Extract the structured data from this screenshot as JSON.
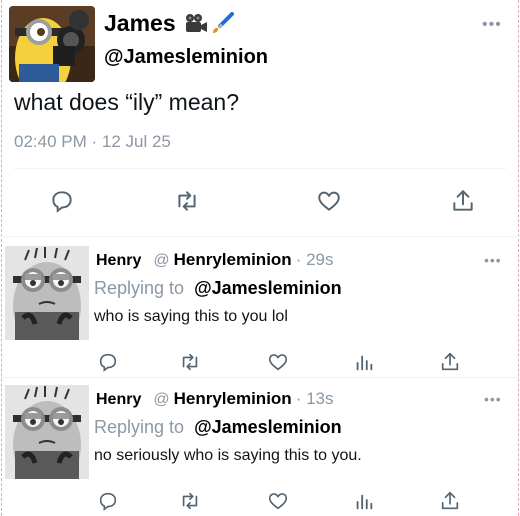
{
  "tweet": {
    "name": "James",
    "emoji_icons": [
      "movie-camera-icon",
      "paintbrush-icon"
    ],
    "handle": "@Jamesleminion",
    "text": "what does “ily” mean?",
    "meta": "02:40 PM · 12 Jul 25",
    "more": "•••"
  },
  "replies": [
    {
      "name": "Henry",
      "at": "@",
      "handle": "Henryleminion",
      "time": "· 29s",
      "replying_label": "Replying to",
      "replying_to": "@Jamesleminion",
      "text": "who is saying this to you lol",
      "more": "•••"
    },
    {
      "name": "Henry",
      "at": "@",
      "handle": "Henryleminion",
      "time": "· 13s",
      "replying_label": "Replying to",
      "replying_to": "@Jamesleminion",
      "text": "no seriously who is saying this to you.",
      "more": "•••"
    }
  ],
  "colors": {
    "icon": "#536471",
    "muted": "#8b98a5",
    "text": "#0f1419",
    "divider": "#eff3f4"
  }
}
